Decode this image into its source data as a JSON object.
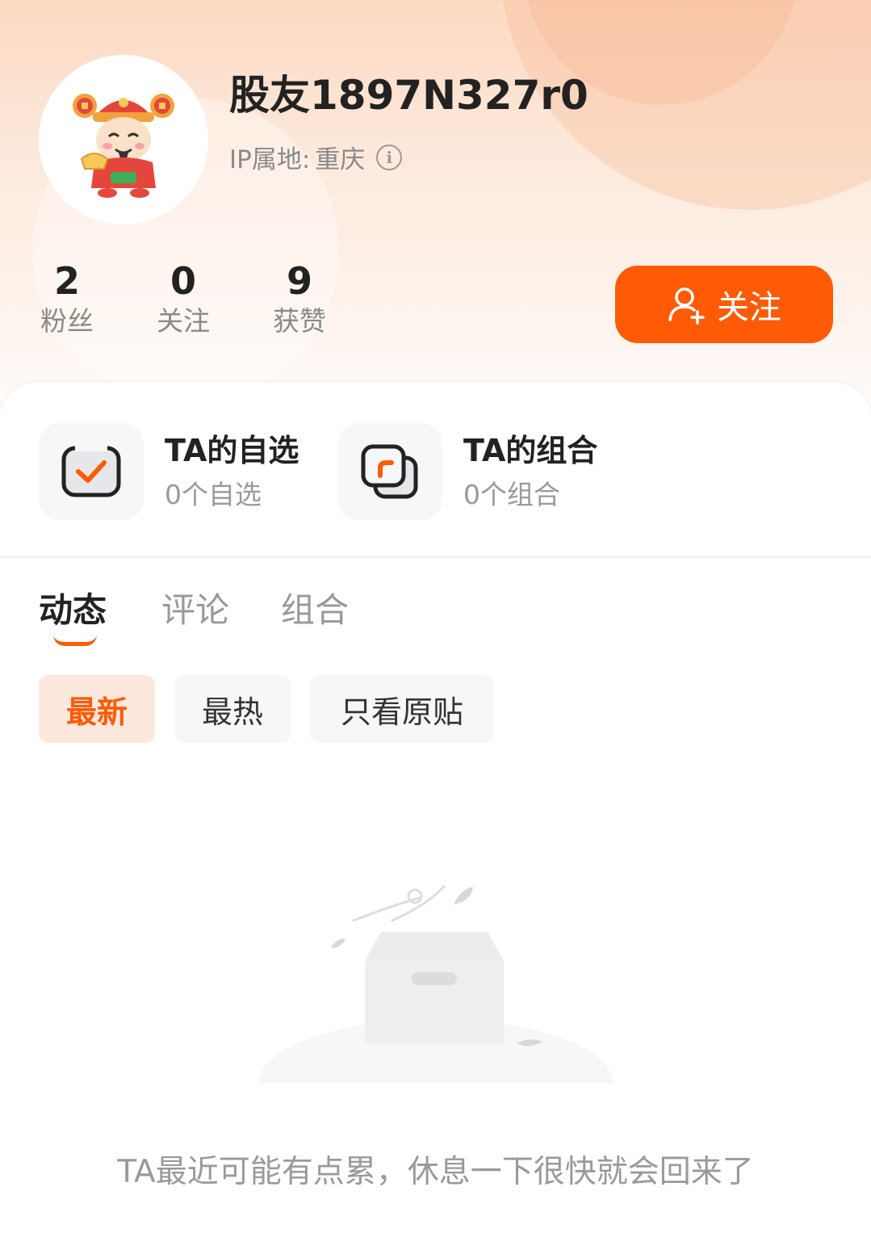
{
  "profile": {
    "username": "股友1897N327r0",
    "ip_label": "IP属地:",
    "ip_value": "重庆",
    "avatar_icon": "fortune-god-avatar-icon"
  },
  "stats": [
    {
      "value": "2",
      "label": "粉丝"
    },
    {
      "value": "0",
      "label": "关注"
    },
    {
      "value": "9",
      "label": "获赞"
    }
  ],
  "follow_button": {
    "label": "关注",
    "icon": "add-user-icon"
  },
  "quick_links": [
    {
      "title": "TA的自选",
      "subtitle": "0个自选",
      "icon": "checkbox-icon"
    },
    {
      "title": "TA的组合",
      "subtitle": "0个组合",
      "icon": "portfolio-icon"
    }
  ],
  "tabs": [
    {
      "label": "动态",
      "active": true
    },
    {
      "label": "评论",
      "active": false
    },
    {
      "label": "组合",
      "active": false
    }
  ],
  "filters": [
    {
      "label": "最新",
      "active": true
    },
    {
      "label": "最热",
      "active": false
    },
    {
      "label": "只看原贴",
      "active": false
    }
  ],
  "empty_state": {
    "message": "TA最近可能有点累，休息一下很快就会回来了",
    "icon": "empty-box-icon"
  },
  "colors": {
    "accent": "#ff5b06",
    "accent_light": "#fde8de",
    "header_gradient_top": "#fcd9c2"
  }
}
